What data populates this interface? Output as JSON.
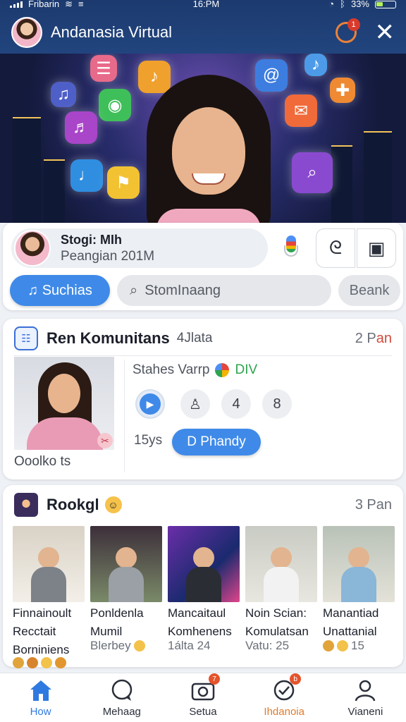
{
  "status_bar": {
    "carrier": "Fribarin",
    "time": "16:PM",
    "battery": "33%"
  },
  "header": {
    "title": "Andanasia Virtual",
    "notification_count": "1"
  },
  "profile": {
    "name": "Stogi: MIh",
    "subtitle": "Peangian 201M"
  },
  "chips": {
    "primary": "Suchias",
    "search_placeholder": "StomInaang",
    "secondary": "Beank"
  },
  "community": {
    "title": "Ren Komunitans",
    "meta": "4Jlata",
    "count_prefix": "2 P",
    "count_suffix": "an",
    "status": "Stahes Varrp",
    "status_tag": "DIV",
    "caption": "Ooolko ts",
    "time": "15ys",
    "cta": "D Phandy",
    "controls": [
      "play",
      "person",
      "4",
      "8"
    ]
  },
  "rookgl": {
    "title": "Rookgl",
    "count": "3 Pan",
    "items": [
      {
        "title_1": "Finnainoult",
        "title_2": "Recctait",
        "sub": "Borniniens"
      },
      {
        "title_1": "Ponldenla",
        "title_2": "Mumil",
        "sub": "Blerbey"
      },
      {
        "title_1": "Mancaitaul",
        "title_2": "Komhenens",
        "sub": "1álta 24"
      },
      {
        "title_1": "Noin Scian:",
        "title_2": "Komulatsan",
        "sub": "Vatu: 25"
      },
      {
        "title_1": "Manantiad",
        "title_2": "Unattanial",
        "sub": "15"
      }
    ]
  },
  "nav": [
    {
      "label": "How",
      "icon": "home-icon",
      "state": "active"
    },
    {
      "label": "Mehaag",
      "icon": "chat-icon",
      "state": ""
    },
    {
      "label": "Setua",
      "icon": "camera-icon",
      "state": "badge",
      "badge": "7"
    },
    {
      "label": "Ihdanoia",
      "icon": "check-icon",
      "state": "highlight",
      "badge": "b"
    },
    {
      "label": "Vianeni",
      "icon": "person-icon",
      "state": ""
    }
  ],
  "colors": {
    "header": "#22457f",
    "accent": "#3f8ae8",
    "highlight": "#e07b2c"
  }
}
